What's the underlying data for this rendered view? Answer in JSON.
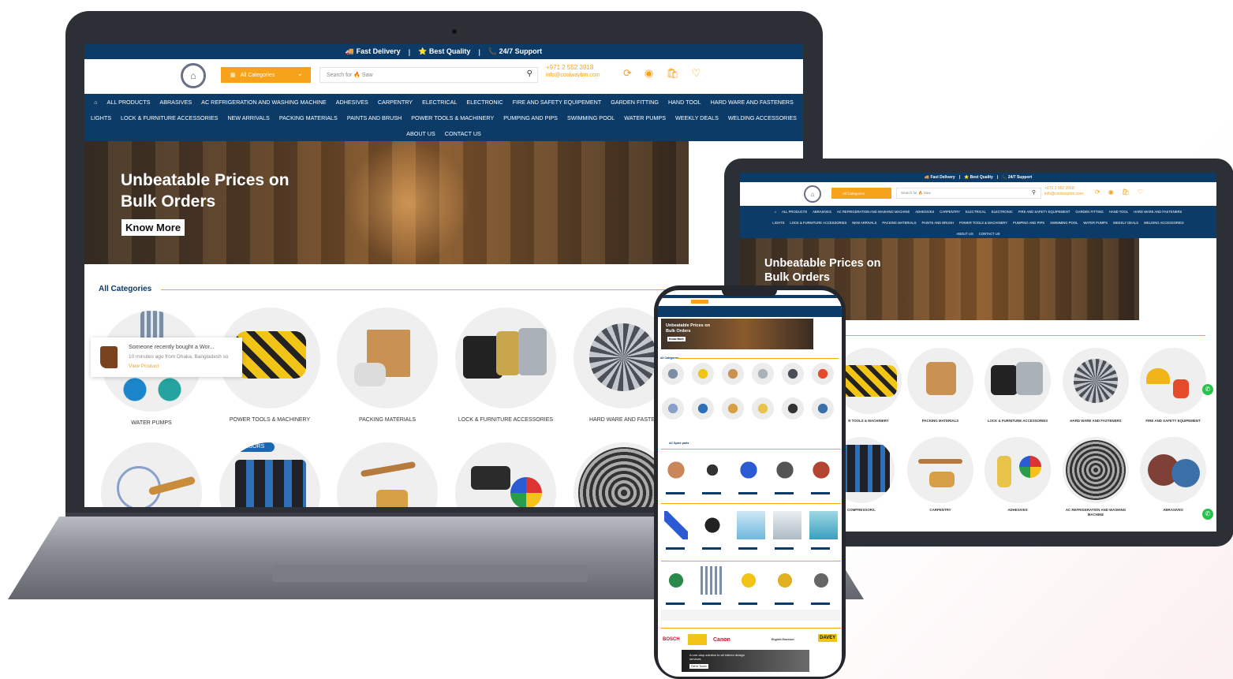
{
  "topbar": {
    "fast_delivery": "🚚 Fast Delivery",
    "best_quality": "⭐ Best Quality",
    "support": "📞 24/7 Support",
    "separator": "|"
  },
  "header": {
    "categories_button": "All Categories",
    "search_placeholder": "Search for 🔥 Saw",
    "phone": "+971 2 552 3918",
    "email": "info@coolwaybm.com"
  },
  "nav": {
    "row1": [
      "ALL PRODUCTS",
      "ABRASIVES",
      "AC REFRIGERATION AND WASHING MACHINE",
      "ADHESIVES",
      "CARPENTRY",
      "ELECTRICAL",
      "ELECTRONIC",
      "FIRE AND SAFETY EQUIPEMENT",
      "GARDEN FITTING",
      "HAND TOOL",
      "HARD WARE AND FASTENERS"
    ],
    "row2": [
      "LIGHTS",
      "LOCK & FURNITURE ACCESSORIES",
      "NEW ARRIVALS",
      "PACKING MATERIALS",
      "PAINTS AND BRUSH",
      "POWER TOOLS & MACHINERY",
      "PUMPING AND PIPS",
      "SWIMMING POOL",
      "WATER PUMPS",
      "WEEKLY DEALS",
      "WELDING ACCESSORIES"
    ],
    "row3": [
      "ABOUT US",
      "CONTACT US"
    ]
  },
  "banner": {
    "line1": "Unbeatable Prices on",
    "line2": "Bulk Orders",
    "cta": "Know More"
  },
  "categories_section": {
    "title": "All Categories",
    "laptop_items": [
      "WATER PUMPS",
      "POWER TOOLS & MACHINERY",
      "PACKING MATERIALS",
      "LOCK & FURNITURE ACCESSORIES",
      "HARD WARE AND FASTEN"
    ],
    "tablet_row1": [
      "R TOOLS & MACHINERY",
      "PACKING MATERIALS",
      "LOCK & FURNITURE ACCESSORIES",
      "HARD WARE AND FASTENERS",
      "FIRE AND SAFETY EQUIPEMENT"
    ],
    "tablet_row2": [
      "COMPRESSORS.",
      "CARPENTRY",
      "ADHESIVES",
      "AC REFRIGERATION AND WASHING MACHINE",
      "ABRASIVES"
    ],
    "compressors_tag": "SSORS"
  },
  "popup": {
    "line1": "Someone recently bought a Wor...",
    "line2": "10 minutes ago from Dhaka, Bangladesh so",
    "link": "View Product"
  },
  "phone": {
    "banner_line1": "Unbeatable Prices on",
    "banner_line2": "Bulk Orders",
    "banner_cta": "Know More",
    "sec_all": "All Categories",
    "sec_ac": "AC Spare parts",
    "brands": [
      "BOSCH",
      "Canon",
      "Englsih Emerson",
      "DAVEY"
    ],
    "footer_banner": "A one-stop solution to all interior design services",
    "footer_cta": "Get in Touch"
  },
  "colors": {
    "navy": "#0b3b66",
    "accent": "#f6a21a",
    "whatsapp": "#27c24c"
  },
  "icons": [
    "home-icon",
    "search-icon",
    "refresh-icon",
    "user-icon",
    "cart-icon",
    "heart-icon",
    "chevron-down-icon",
    "grid-icon",
    "whatsapp-icon"
  ]
}
